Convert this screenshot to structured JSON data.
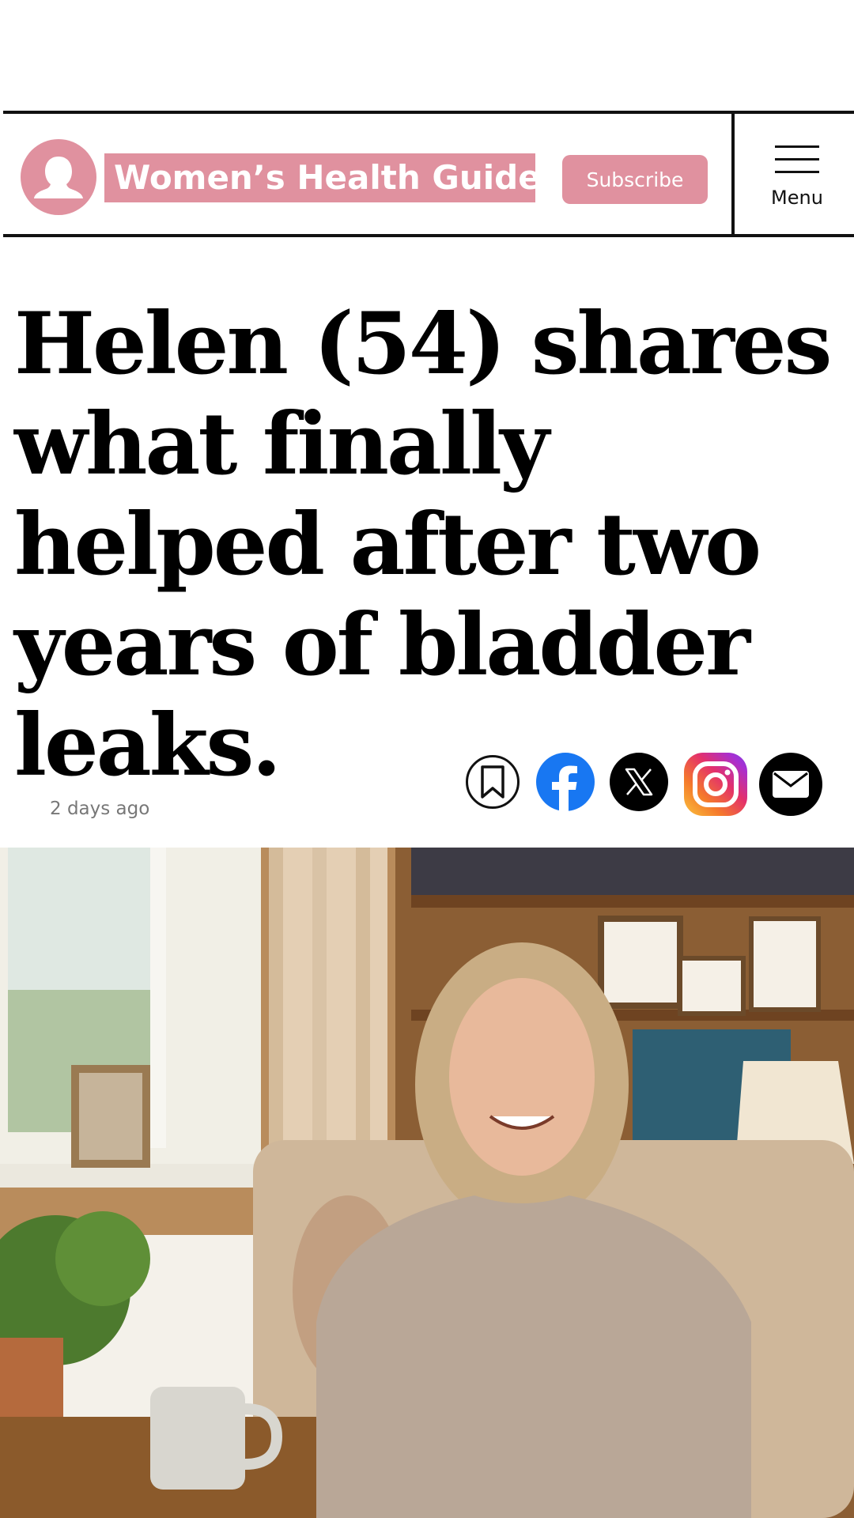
{
  "header": {
    "brand_name": "Women’s Health Guide",
    "subscribe_label": "Subscribe",
    "menu_label": "Menu",
    "brand_color": "#e0919f"
  },
  "article": {
    "headline": "Helen (54) shares what finally helped after two years of bladder leaks.",
    "timestamp": "2 days ago"
  },
  "share": {
    "icons": [
      "bookmark-icon",
      "facebook-icon",
      "x-icon",
      "instagram-icon",
      "email-icon"
    ]
  },
  "hero_image": {
    "description_icon": "photo"
  }
}
